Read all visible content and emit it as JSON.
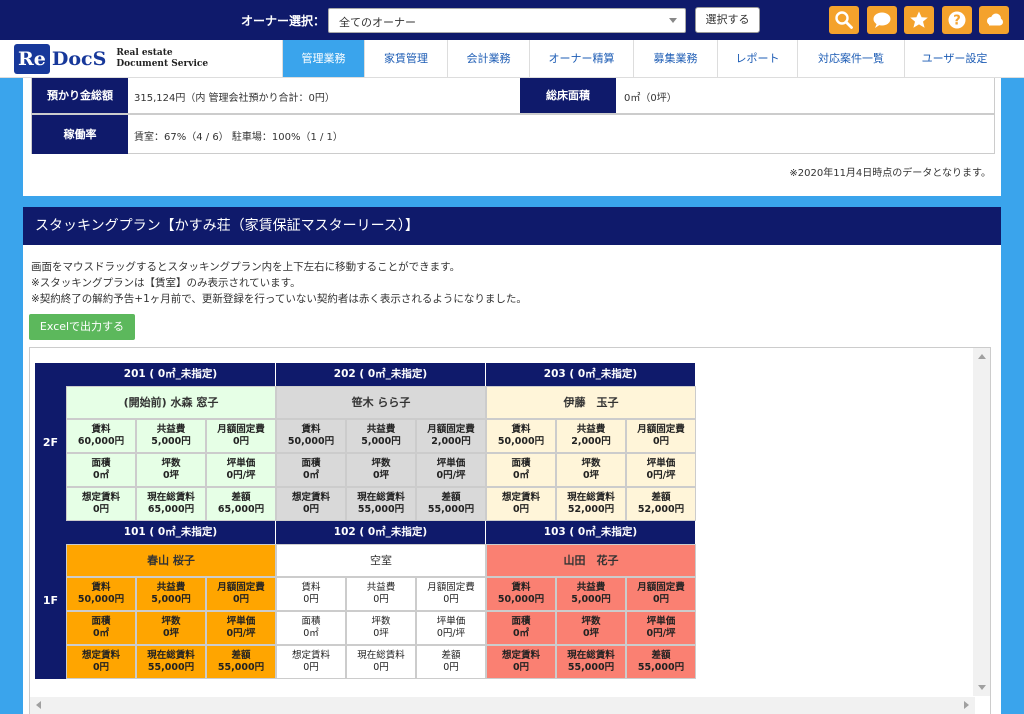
{
  "owner_bar": {
    "label": "オーナー選択：",
    "select_value": "全てのオーナー",
    "select_button": "選択する",
    "icons": [
      "search-icon",
      "chat-icon",
      "star-icon",
      "help-icon",
      "cloud-icon"
    ],
    "accent": "#f4a22c"
  },
  "logo": {
    "re": "Re",
    "docs": "DocS",
    "tag_line1": "Real estate",
    "tag_line2": "Document Service"
  },
  "nav": {
    "tabs": [
      {
        "label": "管理業務",
        "active": true
      },
      {
        "label": "家賃管理"
      },
      {
        "label": "会計業務"
      },
      {
        "label": "オーナー精算"
      },
      {
        "label": "募集業務"
      },
      {
        "label": "レポート"
      },
      {
        "label": "対応案件一覧"
      },
      {
        "label": "ユーザー設定"
      }
    ]
  },
  "info": {
    "deposit_label": "預かり金総額",
    "deposit_value": "315,124円（内 管理会社預かり合計：0円）",
    "area_label": "総床面積",
    "area_value": "0㎡（0坪）",
    "occupancy_label": "稼働率",
    "occupancy_value": "賃室：67%（4 / 6） 駐車場：100%（1 / 1）",
    "note": "※2020年11月4日時点のデータとなります。"
  },
  "stacking": {
    "title": "スタッキングプラン【かすみ荘（家賃保証マスターリース）】",
    "desc1": "画面をマウスドラッグするとスタッキングプラン内を上下左右に移動することができます。",
    "desc2": "※スタッキングプランは【賃室】のみ表示されています。",
    "desc3": "※契約終了の解約予告+1ヶ月前で、更新登録を行っていない契約者は赤く表示されるようになりました。",
    "excel_button": "Excelで出力する",
    "floors": [
      {
        "label": "2F",
        "rooms": [
          {
            "head": "201 ( 0㎡_未指定)",
            "tenant": "(開始前) 水森 窓子",
            "color": "#e6ffe6",
            "bold": true,
            "cells": [
              [
                "賃料",
                "60,000円"
              ],
              [
                "共益費",
                "5,000円"
              ],
              [
                "月額固定費",
                "0円"
              ],
              [
                "面積",
                "0㎡"
              ],
              [
                "坪数",
                "0坪"
              ],
              [
                "坪単価",
                "0円/坪"
              ],
              [
                "想定賃料",
                "0円"
              ],
              [
                "現在総賃料",
                "65,000円"
              ],
              [
                "差額",
                "65,000円"
              ]
            ]
          },
          {
            "head": "202 ( 0㎡_未指定)",
            "tenant": "笹木 らら子",
            "color": "#d9d9d9",
            "bold": true,
            "cells": [
              [
                "賃料",
                "50,000円"
              ],
              [
                "共益費",
                "5,000円"
              ],
              [
                "月額固定費",
                "2,000円"
              ],
              [
                "面積",
                "0㎡"
              ],
              [
                "坪数",
                "0坪"
              ],
              [
                "坪単価",
                "0円/坪"
              ],
              [
                "想定賃料",
                "0円"
              ],
              [
                "現在総賃料",
                "55,000円"
              ],
              [
                "差額",
                "55,000円"
              ]
            ]
          },
          {
            "head": "203 ( 0㎡_未指定)",
            "tenant": "伊藤　玉子",
            "color": "#fff5d9",
            "bold": true,
            "cells": [
              [
                "賃料",
                "50,000円"
              ],
              [
                "共益費",
                "2,000円"
              ],
              [
                "月額固定費",
                "0円"
              ],
              [
                "面積",
                "0㎡"
              ],
              [
                "坪数",
                "0坪"
              ],
              [
                "坪単価",
                "0円/坪"
              ],
              [
                "想定賃料",
                "0円"
              ],
              [
                "現在総賃料",
                "52,000円"
              ],
              [
                "差額",
                "52,000円"
              ]
            ]
          }
        ]
      },
      {
        "label": "1F",
        "rooms": [
          {
            "head": "101 ( 0㎡_未指定)",
            "tenant": "春山 桜子",
            "color": "#ffa500",
            "bold": true,
            "cells": [
              [
                "賃料",
                "50,000円"
              ],
              [
                "共益費",
                "5,000円"
              ],
              [
                "月額固定費",
                "0円"
              ],
              [
                "面積",
                "0㎡"
              ],
              [
                "坪数",
                "0坪"
              ],
              [
                "坪単価",
                "0円/坪"
              ],
              [
                "想定賃料",
                "0円"
              ],
              [
                "現在総賃料",
                "55,000円"
              ],
              [
                "差額",
                "55,000円"
              ]
            ]
          },
          {
            "head": "102 ( 0㎡_未指定)",
            "tenant": "空室",
            "color": "#ffffff",
            "bold": false,
            "cells": [
              [
                "賃料",
                "0円"
              ],
              [
                "共益費",
                "0円"
              ],
              [
                "月額固定費",
                "0円"
              ],
              [
                "面積",
                "0㎡"
              ],
              [
                "坪数",
                "0坪"
              ],
              [
                "坪単価",
                "0円/坪"
              ],
              [
                "想定賃料",
                "0円"
              ],
              [
                "現在総賃料",
                "0円"
              ],
              [
                "差額",
                "0円"
              ]
            ]
          },
          {
            "head": "103 ( 0㎡_未指定)",
            "tenant": "山田　花子",
            "color": "#fa8072",
            "bold": true,
            "cells": [
              [
                "賃料",
                "50,000円"
              ],
              [
                "共益費",
                "5,000円"
              ],
              [
                "月額固定費",
                "0円"
              ],
              [
                "面積",
                "0㎡"
              ],
              [
                "坪数",
                "0坪"
              ],
              [
                "坪単価",
                "0円/坪"
              ],
              [
                "想定賃料",
                "0円"
              ],
              [
                "現在総賃料",
                "55,000円"
              ],
              [
                "差額",
                "55,000円"
              ]
            ]
          }
        ]
      }
    ]
  }
}
